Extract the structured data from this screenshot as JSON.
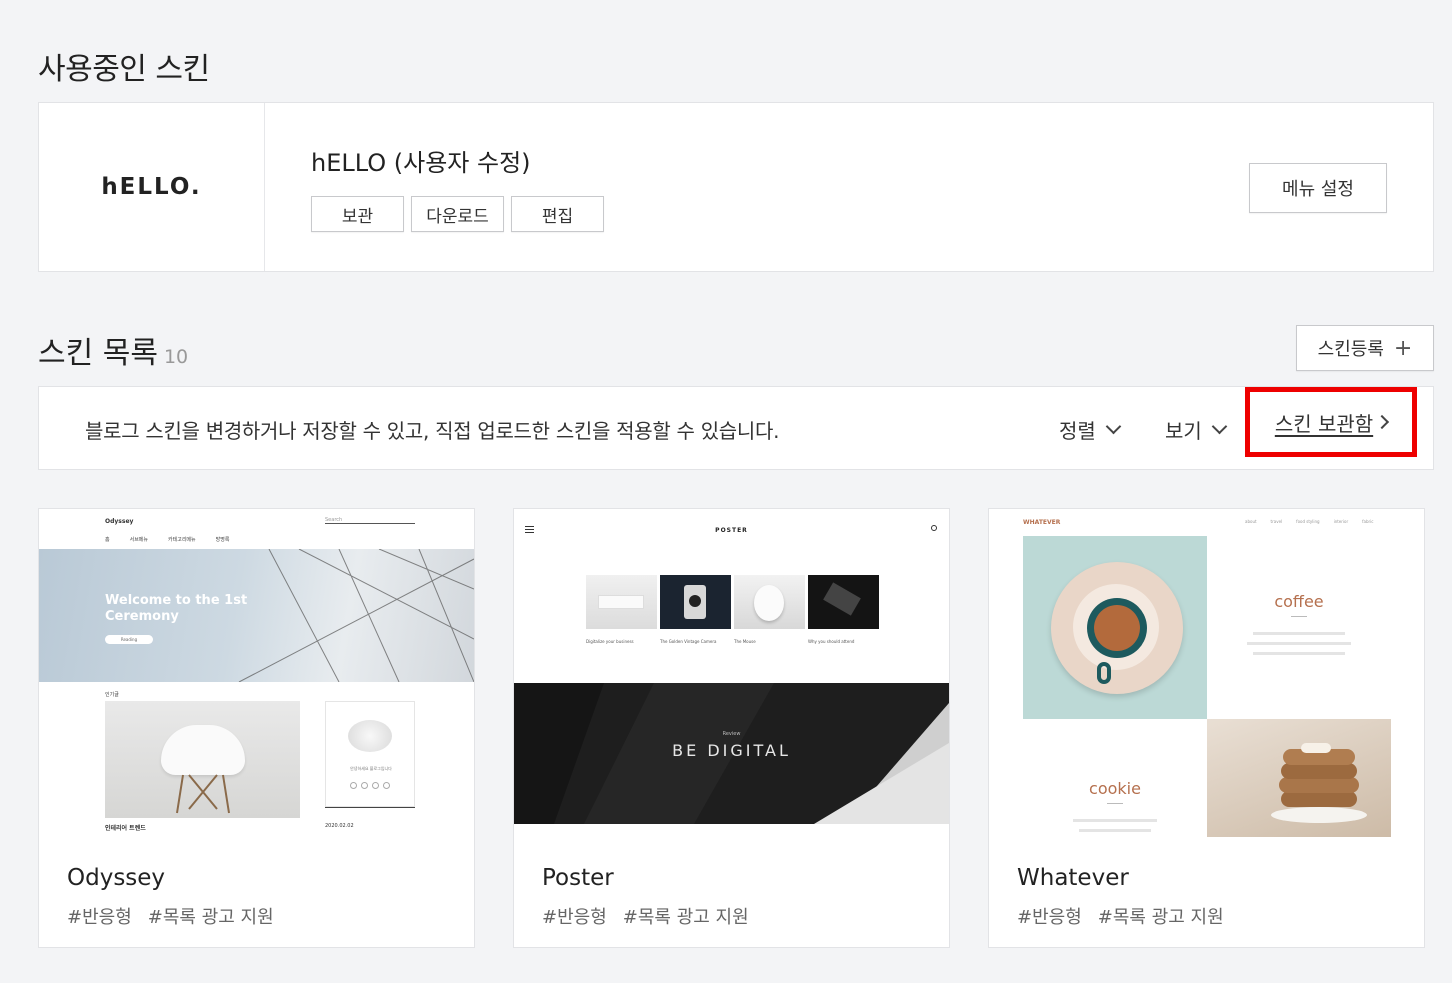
{
  "current_section": {
    "title": "사용중인 스킨",
    "skin_logo": "hELLO.",
    "skin_name": "hELLO (사용자 수정)",
    "buttons": [
      "보관",
      "다운로드",
      "편집"
    ],
    "menu_button": "메뉴 설정"
  },
  "list_section": {
    "title": "스킨 목록",
    "count": "10",
    "register_button": "스킨등록",
    "register_icon": "plus-icon",
    "description": "블로그 스킨을 변경하거나 저장할 수 있고, 직접 업로드한 스킨을 적용할 수 있습니다.",
    "sort_label": "정렬",
    "view_label": "보기",
    "vault_link": "스킨 보관함",
    "highlight_color": "#ee0000"
  },
  "skins": [
    {
      "name": "Odyssey",
      "tags": [
        "#반응형",
        "#목록 광고 지원"
      ],
      "preview": {
        "brand": "Odyssey",
        "search_placeholder": "Search",
        "nav": [
          "홈",
          "서브메뉴",
          "카테고리메뉴",
          "방명록"
        ],
        "hero_title": "Welcome to the 1st Ceremony",
        "hero_button": "Reading",
        "section_label": "인기글",
        "caption": "인테리어 트렌드",
        "side_caption": "안녕하세요 블로그입니다",
        "side_date": "2020.02.02"
      }
    },
    {
      "name": "Poster",
      "tags": [
        "#반응형",
        "#목록 광고 지원"
      ],
      "preview": {
        "brand": "POSTER",
        "items": [
          "Digitalize your business",
          "The Golden Vintage Camera",
          "The Mouse",
          "Why you should attend"
        ],
        "banner_label": "Review",
        "banner_title": "BE DIGITAL"
      }
    },
    {
      "name": "Whatever",
      "tags": [
        "#반응형",
        "#목록 광고 지원"
      ],
      "preview": {
        "brand": "WHATEVER",
        "nav": [
          "about",
          "travel",
          "food styling",
          "interior",
          "fabric"
        ],
        "word1": "coffee",
        "word2": "cookie"
      }
    }
  ]
}
